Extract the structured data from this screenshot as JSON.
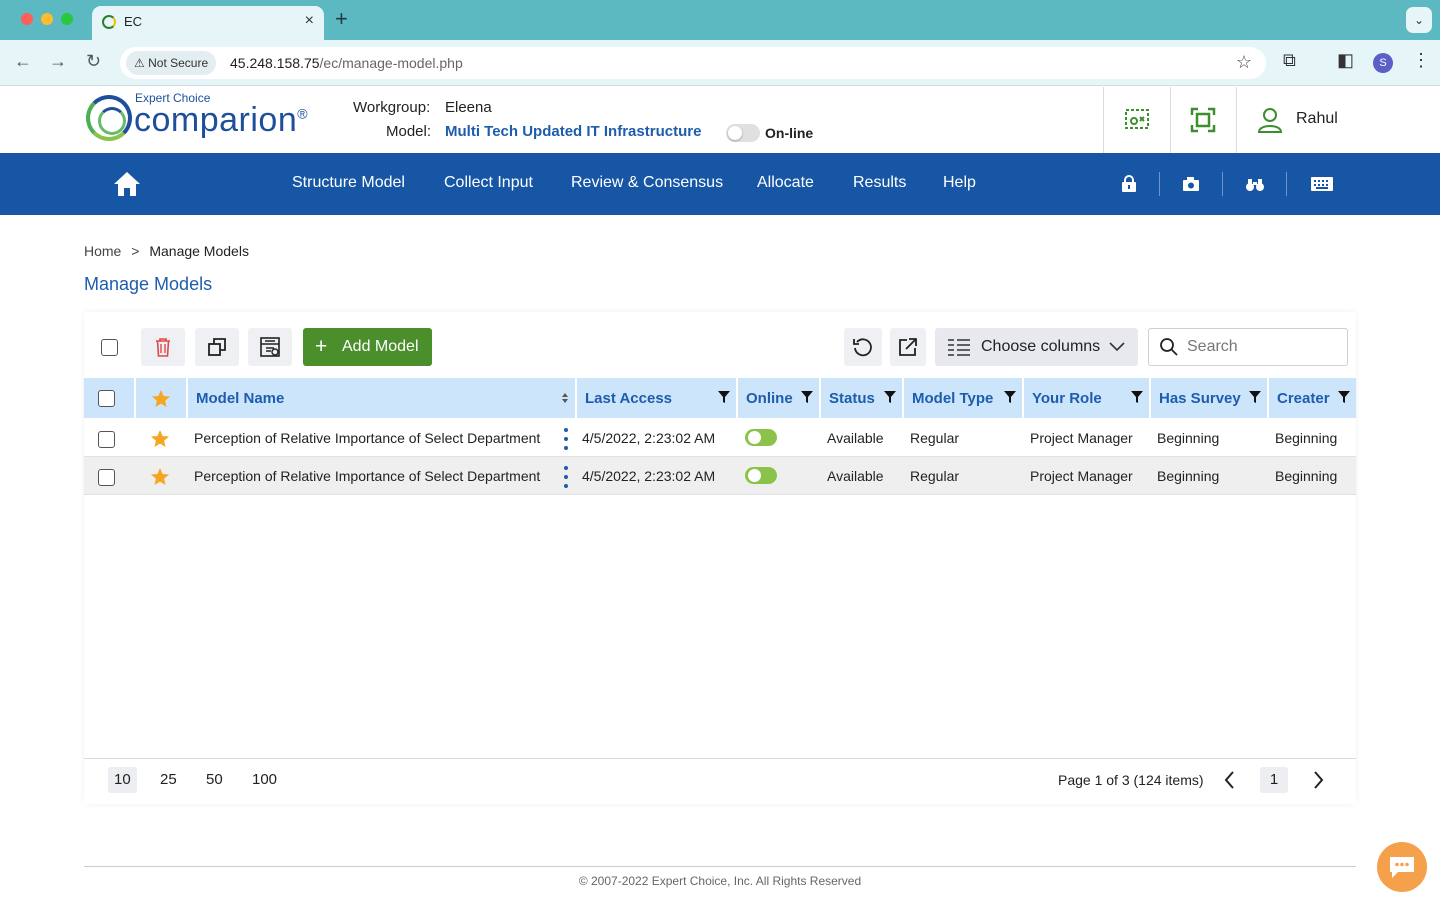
{
  "browser": {
    "tab_title": "EC",
    "not_secure_label": "Not Secure",
    "url_host": "45.248.158.75",
    "url_path": "/ec/manage-model.php",
    "profile_initial": "S"
  },
  "header": {
    "logo_small": "Expert Choice",
    "logo_big": "comparion",
    "workgroup_label": "Workgroup:",
    "workgroup_value": "Eleena",
    "model_label": "Model:",
    "model_value": "Multi Tech Updated IT Infrastructure",
    "online_label": "On-line",
    "user_name": "Rahul"
  },
  "nav": {
    "items": [
      "Structure Model",
      "Collect Input",
      "Review & Consensus",
      "Allocate",
      "Results",
      "Help"
    ]
  },
  "breadcrumb": {
    "home": "Home",
    "separator": ">",
    "current": "Manage Models"
  },
  "page_title": "Manage Models",
  "toolbar": {
    "add_label": "Add Model",
    "choose_columns_label": "Choose columns",
    "search_placeholder": "Search"
  },
  "table": {
    "columns": [
      "Model Name",
      "Last Access",
      "Online",
      "Status",
      "Model Type",
      "Your Role",
      "Has Survey",
      "Creater"
    ],
    "rows": [
      {
        "name": "Perception of Relative Importance of Select Department",
        "last_access": "4/5/2022, 2:23:02 AM",
        "online": true,
        "status": "Available",
        "model_type": "Regular",
        "role": "Project Manager",
        "has_survey": "Beginning",
        "creater": "Beginning"
      },
      {
        "name": "Perception of Relative Importance of Select Department",
        "last_access": "4/5/2022, 2:23:02 AM",
        "online": true,
        "status": "Available",
        "model_type": "Regular",
        "role": "Project Manager",
        "has_survey": "Beginning",
        "creater": "Beginning"
      }
    ]
  },
  "pager": {
    "sizes": [
      "10",
      "25",
      "50",
      "100"
    ],
    "selected_size": "10",
    "info": "Page  1 of  3  (124 items)",
    "current_page": "1"
  },
  "footer": "© 2007-2022 Expert Choice, Inc. All Rights Reserved",
  "colors": {
    "nav": "#1656a5",
    "accent_green": "#4a8f2c",
    "header_row": "#cce5fb",
    "star": "#f5a623"
  }
}
